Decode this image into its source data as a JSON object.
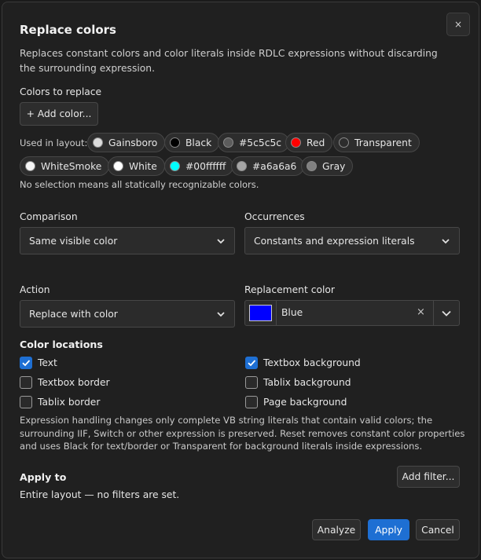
{
  "dialog": {
    "title": "Replace colors",
    "description": "Replaces constant colors and color literals inside RDLC expressions without discarding the surrounding expression.",
    "close_label": "×"
  },
  "colors_to_replace": {
    "label": "Colors to replace",
    "add_button": "+ Add color...",
    "used_in_layout_label": "Used in layout:",
    "chips": [
      {
        "label": "Gainsboro",
        "color": "#dcdcdc"
      },
      {
        "label": "Black",
        "color": "#000000"
      },
      {
        "label": "#5c5c5c",
        "color": "#5c5c5c"
      },
      {
        "label": "Red",
        "color": "#ff0000"
      },
      {
        "label": "Transparent",
        "color": "transparent"
      },
      {
        "label": "WhiteSmoke",
        "color": "#f5f5f5"
      },
      {
        "label": "White",
        "color": "#ffffff"
      },
      {
        "label": "#00ffffff",
        "color": "#00ffff"
      },
      {
        "label": "#a6a6a6",
        "color": "#a6a6a6"
      },
      {
        "label": "Gray",
        "color": "#808080"
      }
    ],
    "hint": "No selection means all statically recognizable colors."
  },
  "comparison": {
    "label": "Comparison",
    "value": "Same visible color"
  },
  "occurrences": {
    "label": "Occurrences",
    "value": "Constants and expression literals"
  },
  "action": {
    "label": "Action",
    "value": "Replace with color"
  },
  "replacement_color": {
    "label": "Replacement color",
    "value": "Blue",
    "swatch": "#0000ff",
    "clear_label": "×"
  },
  "color_locations": {
    "label": "Color locations",
    "items": [
      {
        "label": "Text",
        "checked": true
      },
      {
        "label": "Textbox border",
        "checked": false
      },
      {
        "label": "Tablix border",
        "checked": false
      },
      {
        "label": "Textbox background",
        "checked": true
      },
      {
        "label": "Tablix background",
        "checked": false
      },
      {
        "label": "Page background",
        "checked": false
      }
    ],
    "note": "Expression handling changes only complete VB string literals that contain valid colors; the surrounding IIF, Switch or other expression is preserved. Reset removes constant color properties and uses Black for text/border or Transparent for background literals inside expressions."
  },
  "apply_to": {
    "label": "Apply to",
    "status": "Entire layout — no filters are set.",
    "add_filter_button": "Add filter..."
  },
  "footer": {
    "analyze": "Analyze",
    "apply": "Apply",
    "cancel": "Cancel"
  },
  "theme": {
    "accent": "#1e6fd3",
    "background": "#202020"
  }
}
